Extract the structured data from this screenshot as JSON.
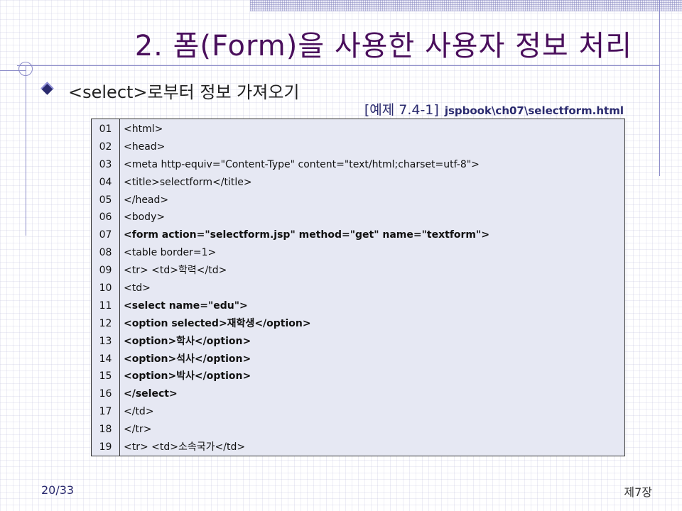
{
  "slide": {
    "title": "2. 폼(Form)을 사용한 사용자 정보 처리",
    "bullet_text": "<select>로부터 정보 가져오기",
    "example_label": "[예제 7.4-1]",
    "example_path": "jspbook\\ch07\\selectform.html",
    "page": "20/33",
    "chapter": "제7장"
  },
  "code": {
    "lines": [
      {
        "num": "01",
        "text": "<html>",
        "bold": false
      },
      {
        "num": "02",
        "text": "<head>",
        "bold": false
      },
      {
        "num": "03",
        "text": "<meta http-equiv=\"Content-Type\" content=\"text/html;charset=utf-8\">",
        "bold": false
      },
      {
        "num": "04",
        "text": "<title>selectform</title>",
        "bold": false
      },
      {
        "num": "05",
        "text": "</head>",
        "bold": false
      },
      {
        "num": "06",
        "text": "<body>",
        "bold": false
      },
      {
        "num": "07",
        "text": "<form action=\"selectform.jsp\" method=\"get\" name=\"textform\">",
        "bold": true
      },
      {
        "num": "08",
        "text": "<table border=1>",
        "bold": false
      },
      {
        "num": "09",
        "text": "<tr> <td>학력</td>",
        "bold": false
      },
      {
        "num": "10",
        "text": "<td>",
        "bold": false
      },
      {
        "num": "11",
        "text": "<select name=\"edu\">",
        "bold": true
      },
      {
        "num": "12",
        "text": "<option selected>재학생</option>",
        "bold": true
      },
      {
        "num": "13",
        "text": "<option>학사</option>",
        "bold": true
      },
      {
        "num": "14",
        "text": "<option>석사</option>",
        "bold": true
      },
      {
        "num": "15",
        "text": "<option>박사</option>",
        "bold": true
      },
      {
        "num": "16",
        "text": "</select>",
        "bold": true
      },
      {
        "num": "17",
        "text": "</td>",
        "bold": false
      },
      {
        "num": "18",
        "text": "</tr>",
        "bold": false
      },
      {
        "num": "19",
        "text": "<tr> <td>소속국가</td>",
        "bold": false
      }
    ]
  },
  "colors": {
    "title": "#4a0f5c",
    "accent": "#2a2a6e",
    "code_bg": "#e6e8f3"
  }
}
